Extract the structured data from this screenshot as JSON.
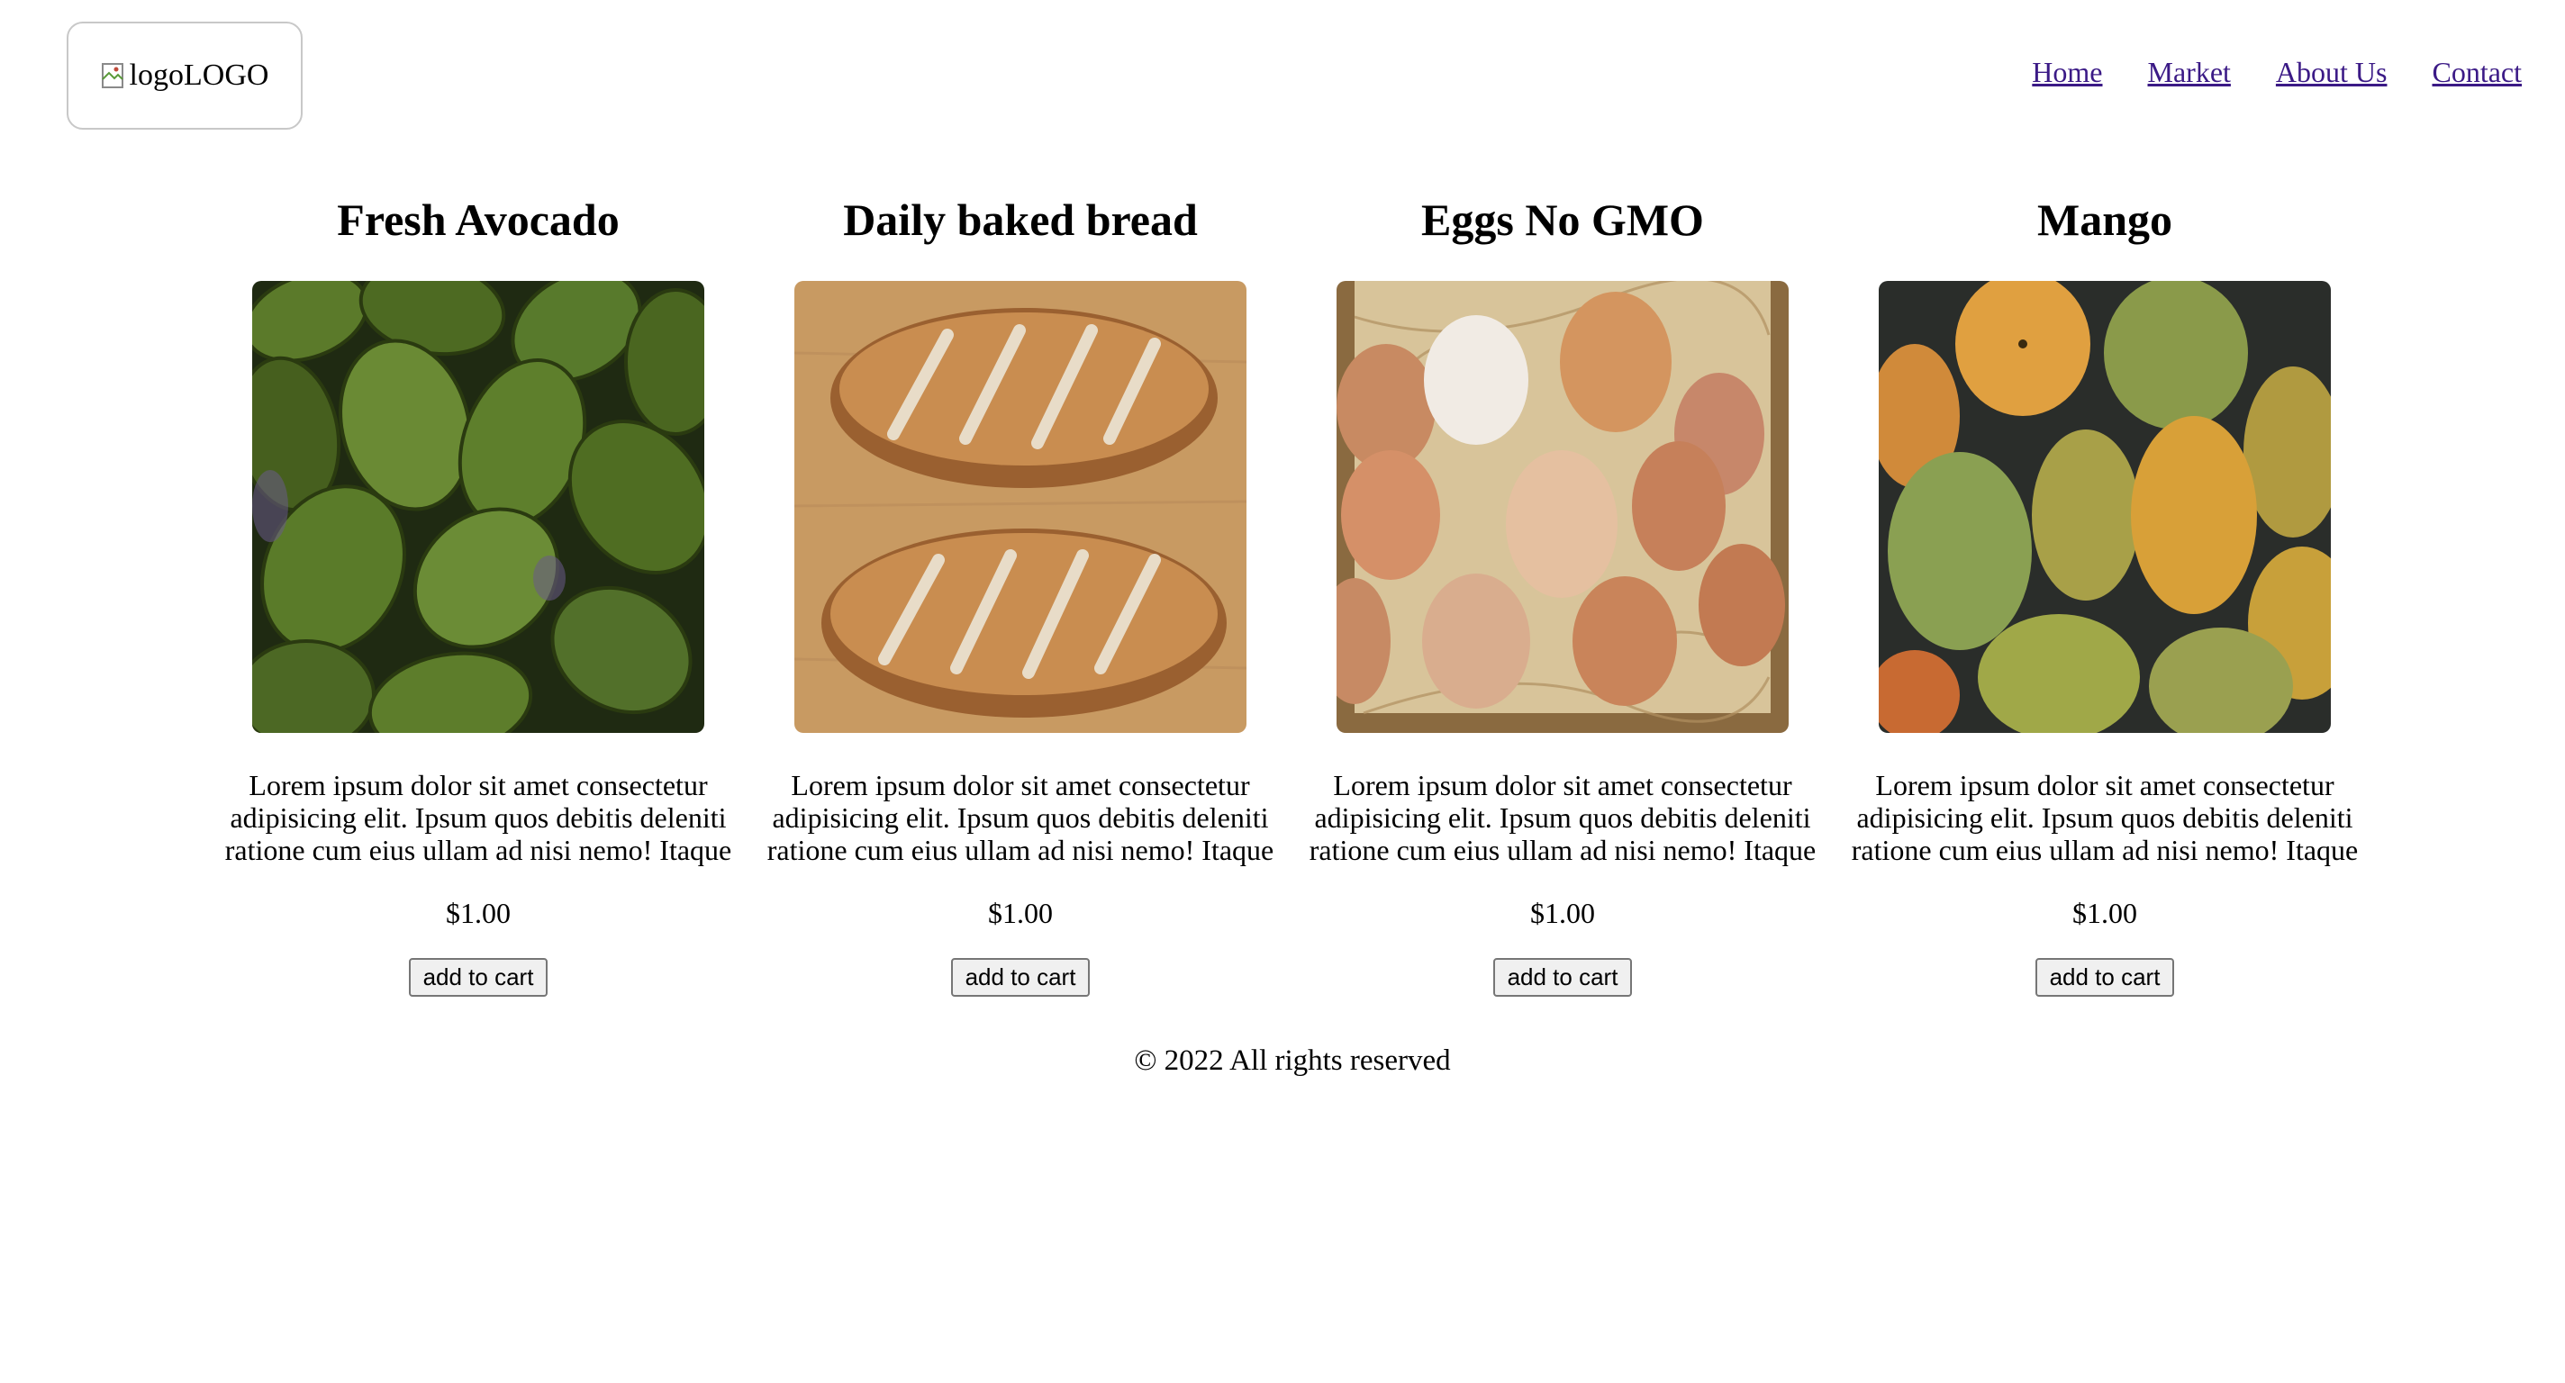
{
  "header": {
    "logo_alt": "logo",
    "logo_text": "LOGO",
    "nav": [
      "Home",
      "Market",
      "About Us",
      "Contact"
    ]
  },
  "products": [
    {
      "title": "Fresh Avocado",
      "description": "Lorem ipsum dolor sit amet consectetur adipisicing elit. Ipsum quos debitis deleniti ratione cum eius ullam ad nisi nemo! Itaque",
      "price": "$1.00",
      "button": "add to cart",
      "image": "avocado-photo"
    },
    {
      "title": "Daily baked bread",
      "description": "Lorem ipsum dolor sit amet consectetur adipisicing elit. Ipsum quos debitis deleniti ratione cum eius ullam ad nisi nemo! Itaque",
      "price": "$1.00",
      "button": "add to cart",
      "image": "bread-photo"
    },
    {
      "title": "Eggs No GMO",
      "description": "Lorem ipsum dolor sit amet consectetur adipisicing elit. Ipsum quos debitis deleniti ratione cum eius ullam ad nisi nemo! Itaque",
      "price": "$1.00",
      "button": "add to cart",
      "image": "eggs-photo"
    },
    {
      "title": "Mango",
      "description": "Lorem ipsum dolor sit amet consectetur adipisicing elit. Ipsum quos debitis deleniti ratione cum eius ullam ad nisi nemo! Itaque",
      "price": "$1.00",
      "button": "add to cart",
      "image": "mango-photo"
    }
  ],
  "footer": {
    "copyright": "© 2022 All rights reserved"
  },
  "colors": {
    "link": "#3b1a86",
    "logo_border": "#c8c8c8"
  }
}
